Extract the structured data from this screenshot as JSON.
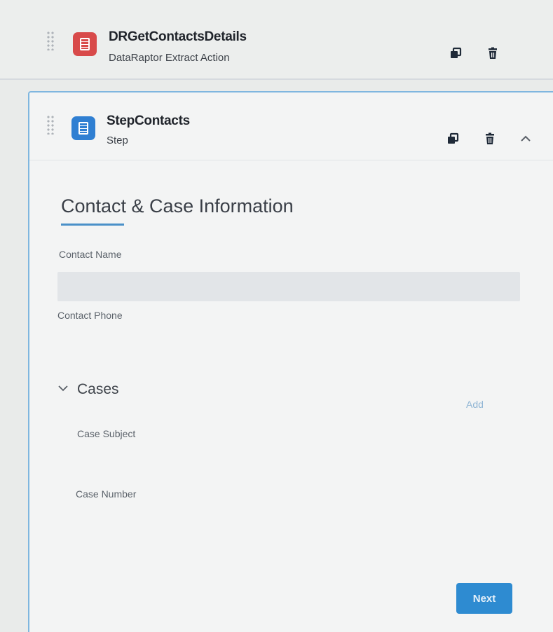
{
  "action_element": {
    "name": "DRGetContactsDetails",
    "type": "DataRaptor Extract Action",
    "icon": "datarapter-icon",
    "icon_color": "#d84a4a"
  },
  "step_element": {
    "name": "StepContacts",
    "type": "Step",
    "icon": "step-icon",
    "icon_color": "#2f7fd2"
  },
  "form": {
    "section_title": "Contact & Case Information",
    "contact_name_label": "Contact Name",
    "contact_phone_label": "Contact Phone",
    "block_title": "Cases",
    "add_label": "Add",
    "case_subject_label": "Case Subject",
    "case_number_label": "Case Number",
    "next_label": "Next"
  },
  "colors": {
    "accent": "#2e8bd1",
    "panel_border": "#7fb6df"
  }
}
